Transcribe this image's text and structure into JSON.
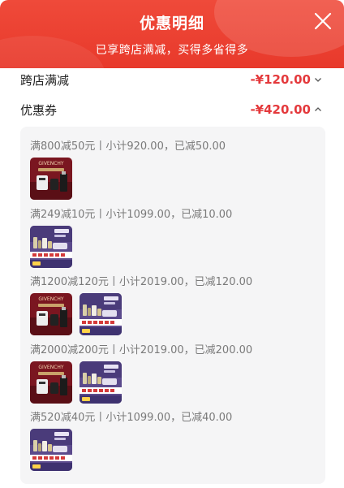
{
  "header": {
    "title": "优惠明细",
    "subtitle": "已享跨店满减，买得多省得多"
  },
  "summary": [
    {
      "label": "跨店满减",
      "amount": "-¥120.00",
      "chevron": "chevron-down-icon"
    },
    {
      "label": "优惠券",
      "amount": "-¥420.00",
      "chevron": "chevron-up-icon"
    }
  ],
  "coupon_groups": [
    {
      "rule": "满800减50元丨小计920.00，已减50.00",
      "products": [
        "givenchy-perfume-gift-box"
      ]
    },
    {
      "rule": "满249减10元丨小计1099.00，已减10.00",
      "products": [
        "skincare-gift-set"
      ]
    },
    {
      "rule": "满1200减120元丨小计2019.00，已减120.00",
      "products": [
        "givenchy-perfume-gift-box",
        "skincare-gift-set"
      ]
    },
    {
      "rule": "满2000减200元丨小计2019.00，已减200.00",
      "products": [
        "givenchy-perfume-gift-box",
        "skincare-gift-set"
      ]
    },
    {
      "rule": "满520减40元丨小计1099.00，已减40.00",
      "products": [
        "skincare-gift-set"
      ]
    }
  ],
  "products": {
    "givenchy-perfume-gift-box": {
      "brand_text": "GIVENCHY"
    }
  },
  "colors": {
    "header_red": "#e8392b",
    "price_red": "#e4393c",
    "card_bg": "#f5f5f6",
    "rule_text": "#7a7a7a"
  }
}
